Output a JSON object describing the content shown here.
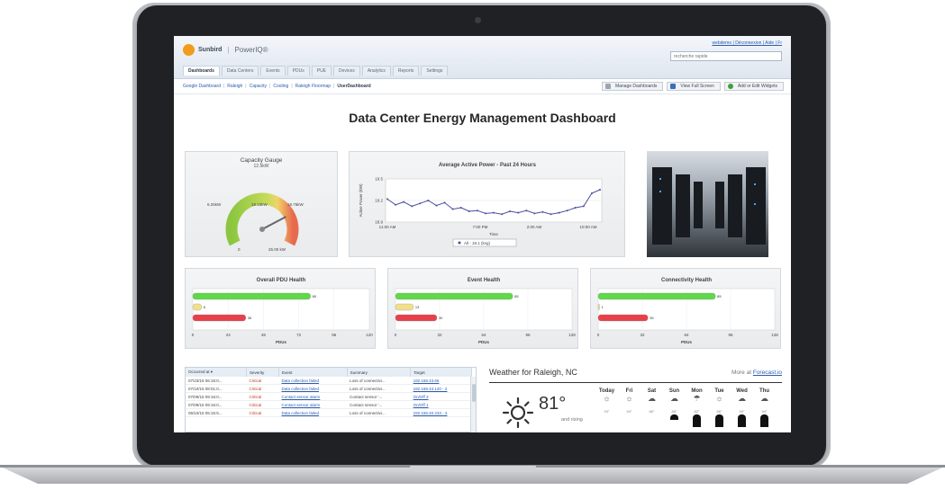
{
  "header": {
    "brand": "Sunbird",
    "product": "PowerIQ®",
    "user_links": "webdemo | Déconnexion | Aide | Fr",
    "search_placeholder": "recherche rapide"
  },
  "tabs": [
    {
      "label": "Dashboards",
      "active": true
    },
    {
      "label": "Data Centers"
    },
    {
      "label": "Events"
    },
    {
      "label": "PDUs"
    },
    {
      "label": "PUE"
    },
    {
      "label": "Devices"
    },
    {
      "label": "Analytics"
    },
    {
      "label": "Reports"
    },
    {
      "label": "Settings"
    }
  ],
  "subnav": {
    "items": [
      "Google Dashboard",
      "Raleigh",
      "Capacity",
      "Cooling",
      "Raleigh Floormap"
    ],
    "current": "UserDashboard"
  },
  "actions": {
    "manage": "Manage Dashboards",
    "fullscreen": "View Full Screen",
    "widgets": "Add or Edit Widgets"
  },
  "page_title": "Data Center Energy Management Dashboard",
  "capacity_gauge": {
    "title": "Capacity Gauge",
    "top_value": "12.5kW",
    "left_value": "6.25kW",
    "center_value": "19.15kW",
    "right_value": "18.75kW",
    "min_value": "0",
    "max_value": "25.00 kW",
    "current_kw": 19.15,
    "max_kw": 25
  },
  "chart_data": [
    {
      "type": "line",
      "title": "Average Active Power - Past 24 Hours",
      "xlabel": "Time",
      "ylabel": "Active Power (kW)",
      "x_ticks": [
        "11:00 AM",
        "7:00 PM",
        "2:00 AM",
        "10:00 AM"
      ],
      "y_ticks": [
        "18.9",
        "19.2",
        "19.5"
      ],
      "ylim": [
        18.9,
        19.5
      ],
      "legend": "All - 19.1 (kvg)",
      "series": [
        {
          "values": [
            19.22,
            19.14,
            19.18,
            19.12,
            19.16,
            19.2,
            19.13,
            19.17,
            19.08,
            19.1,
            19.05,
            19.06,
            19.02,
            19.03,
            19.01,
            19.05,
            19.03,
            19.06,
            19.02,
            19.04,
            19.01,
            19.03,
            19.06,
            19.1,
            19.12,
            19.3,
            19.35
          ]
        }
      ]
    },
    {
      "type": "bar",
      "title": "Overall PDU Health",
      "xlabel": "PDUs",
      "x_ticks": [
        "0",
        "24",
        "48",
        "72",
        "96",
        "120"
      ],
      "xlim": [
        0,
        120
      ],
      "values": [
        80,
        6,
        36
      ],
      "colors": [
        "#5fd94a",
        "#f1e08a",
        "#e8404a"
      ]
    },
    {
      "type": "bar",
      "title": "Event Health",
      "xlabel": "PDUs",
      "x_ticks": [
        "0",
        "32",
        "64",
        "96",
        "128"
      ],
      "xlim": [
        0,
        128
      ],
      "values": [
        85,
        13,
        30
      ],
      "colors": [
        "#5fd94a",
        "#f1e08a",
        "#e8404a"
      ]
    },
    {
      "type": "bar",
      "title": "Connectivity Health",
      "xlabel": "PDUs",
      "x_ticks": [
        "0",
        "32",
        "64",
        "96",
        "128"
      ],
      "xlim": [
        0,
        128
      ],
      "values": [
        85,
        1,
        36
      ],
      "colors": [
        "#5fd94a",
        "#f1e08a",
        "#e8404a"
      ]
    }
  ],
  "events": {
    "columns": [
      "Occurred at ▾",
      "Severity",
      "Event",
      "Summary",
      "Target"
    ],
    "rows": [
      [
        "07/23/15 06:16:0...",
        "Critical",
        "Data collection failed",
        "Loss of connectivi...",
        "192.168.43.66"
      ],
      [
        "07/10/15 08:01:0...",
        "Critical",
        "Data collection failed",
        "Loss of connectivi...",
        "192.168.43.120 - 2"
      ],
      [
        "07/09/15 09:16:0...",
        "Critical",
        "Contact sensor alarm",
        "Contact sensor '...",
        "On/Off 3"
      ],
      [
        "07/09/15 09:16:0...",
        "Critical",
        "Contact sensor alarm",
        "Contact sensor '...",
        "On/Off 1"
      ],
      [
        "06/10/15 05:15:5...",
        "Critical",
        "Data collection failed",
        "Loss of connectivi...",
        "192.168.40.233 - 3"
      ]
    ]
  },
  "weather": {
    "title": "Weather for Raleigh, NC",
    "more_prefix": "More at",
    "more_link": "Forecast.io",
    "temp": "81°",
    "trend": "and rising",
    "days": [
      {
        "name": "Today",
        "icon": "☼",
        "hi": "93°"
      },
      {
        "name": "Fri",
        "icon": "☼",
        "hi": "94°"
      },
      {
        "name": "Sat",
        "icon": "☁",
        "hi": "86°"
      },
      {
        "name": "Sun",
        "icon": "☁",
        "hi": "85°"
      },
      {
        "name": "Mon",
        "icon": "☂",
        "hi": "82°"
      },
      {
        "name": "Tue",
        "icon": "☼",
        "hi": "86°"
      },
      {
        "name": "Wed",
        "icon": "☁",
        "hi": "90°"
      },
      {
        "name": "Thu",
        "icon": "☁",
        "hi": "94°"
      }
    ]
  }
}
